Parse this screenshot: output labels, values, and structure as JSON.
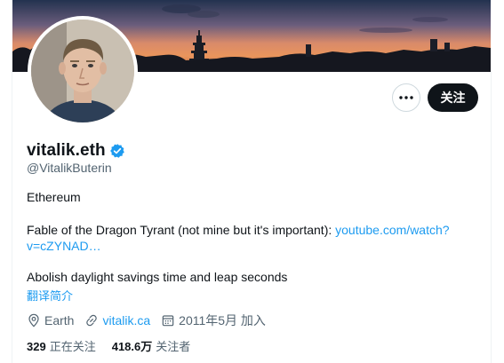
{
  "profile": {
    "display_name": "vitalik.eth",
    "handle": "@VitalikButerin",
    "verified": true
  },
  "actions": {
    "more_label": "•••",
    "follow_label": "关注"
  },
  "bio": {
    "line1": "Ethereum",
    "line2_text": "Fable of the Dragon Tyrant (not mine but it's important): ",
    "line2_link": "youtube.com/watch?",
    "line3_link": "v=cZYNAD…",
    "line4": "Abolish daylight savings time and leap seconds",
    "translate_label": "翻译简介"
  },
  "meta": {
    "location": "Earth",
    "website": "vitalik.ca",
    "joined": "2011年5月 加入"
  },
  "stats": {
    "following_count": "329",
    "following_label": "正在关注",
    "followers_count": "418.6万",
    "followers_label": "关注者"
  },
  "icons": {
    "more": "more-horizontal-icon",
    "verified": "verified-badge-icon",
    "location": "location-pin-icon",
    "link": "link-icon",
    "calendar": "calendar-icon"
  },
  "colors": {
    "accent": "#1d9bf0",
    "follow_button": "#0f1419",
    "secondary_text": "#536471"
  }
}
